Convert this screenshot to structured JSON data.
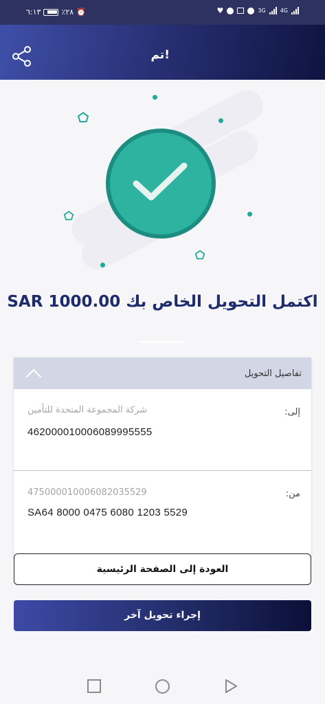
{
  "status_bar": {
    "time": "٦:١٣",
    "battery_percent": "٪٢٨",
    "network_1": "3G",
    "network_2": "4G"
  },
  "header": {
    "title": "تم!"
  },
  "message": {
    "headline": "اكتمل التحويل الخاص بك SAR 1000.00"
  },
  "details": {
    "title": "تفاصيل التحويل",
    "to": {
      "label": "إلى:",
      "name": "شركة المجموعة المتحدة للتأمين",
      "account": "462000010006089995555"
    },
    "from": {
      "label": "من:",
      "account": "475000010006082035529",
      "iban": "SA64 8000 0475 6080 1203 5529"
    }
  },
  "buttons": {
    "home": "العودة إلى الصفحة الرئيسية",
    "new_transfer": "إجراء تحويل آخر"
  },
  "colors": {
    "brand": "#2a3278",
    "success": "#2eb3a1",
    "headline": "#1f2c6b"
  },
  "icons": {
    "share": "share-icon",
    "check": "check-icon",
    "collapse": "chevron-up-icon"
  }
}
